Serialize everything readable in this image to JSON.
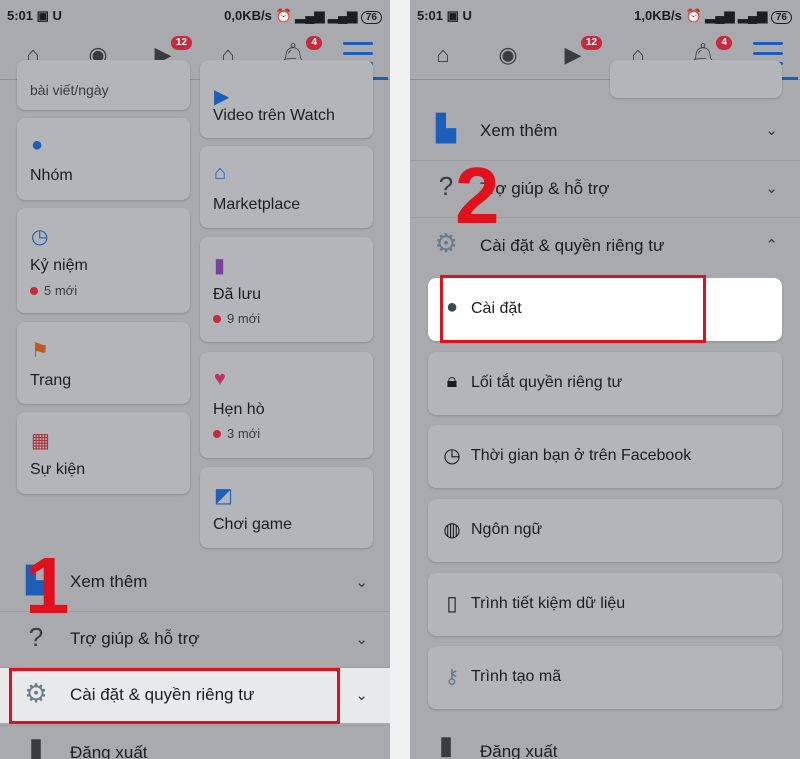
{
  "accent": "#1d5fb8",
  "highlight": "#e0101c",
  "left": {
    "status": {
      "time": "5:01",
      "speed": "0,0KB/s",
      "battery": "76"
    },
    "nav": {
      "watch_badge": "12",
      "notif_badge": "4"
    },
    "cards": [
      {
        "title": "bài viết/ngày"
      },
      {
        "title": "Nhóm",
        "icon": "groups-icon"
      },
      {
        "title": "Kỷ niệm",
        "sub": "5 mới",
        "icon": "memories-icon"
      },
      {
        "title": "Trang",
        "icon": "flag-icon"
      },
      {
        "title": "Sự kiện",
        "icon": "calendar-icon"
      },
      {
        "title": "Video trên Watch",
        "icon": "watch-icon"
      },
      {
        "title": "Marketplace",
        "icon": "shop-icon"
      },
      {
        "title": "Đã lưu",
        "sub": "9 mới",
        "icon": "bookmark-icon"
      },
      {
        "title": "Hẹn hò",
        "sub": "3 mới",
        "icon": "heart-icon"
      },
      {
        "title": "Chơi game",
        "icon": "game-icon"
      }
    ],
    "rows": [
      "Xem thêm",
      "Trợ giúp & hỗ trợ",
      "Cài đặt & quyền riêng tư",
      "Đăng xuất"
    ],
    "step": "1"
  },
  "right": {
    "status": {
      "time": "5:01",
      "speed": "1,0KB/s",
      "battery": "76"
    },
    "nav": {
      "watch_badge": "12",
      "notif_badge": "4"
    },
    "rows": [
      "Xem thêm",
      "Trợ giúp & hỗ trợ",
      "Cài đặt & quyền riêng tư",
      "Đăng xuất"
    ],
    "subs": [
      "Cài đặt",
      "Lối tắt quyền riêng tư",
      "Thời gian bạn ở trên Facebook",
      "Ngôn ngữ",
      "Trình tiết kiệm dữ liệu",
      "Trình tạo mã"
    ],
    "step": "2"
  }
}
